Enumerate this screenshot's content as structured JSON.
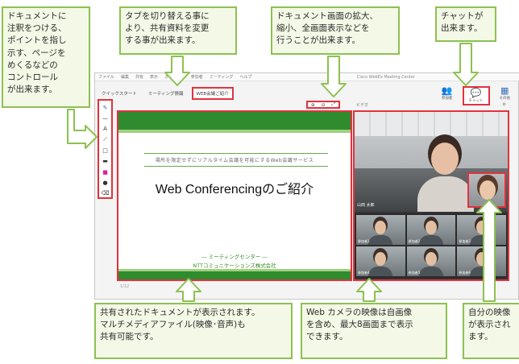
{
  "callouts": {
    "document_controls": "ドキュメントに\n注釈をつける、\nポイントを指し\n示す、ページを\nめくるなどの\nコントロール\nが出来ます。",
    "tabs": "タブを切り替える事に\nより、共有資料を変更\nする事が出来ます。",
    "zoom": "ドキュメント画面の拡大、\n縮小、全画面表示などを\n行うことが出来ます。",
    "chat": "チャットが\n出来ます。",
    "shared_document": "共有されたドキュメントが表示されます。\nマルチメディアファイル(映像･音声)も\n共有可能です。",
    "webcam": "Web カメラの映像は自画像\nを含め、最大8画面まで表示\nできます。",
    "self_view": "自分の映像\nが表示され\nます。"
  },
  "app": {
    "title": "Cisco WebEx Meeting Center",
    "menu": [
      "ファイル",
      "編集",
      "共有",
      "表示",
      "オーディオ",
      "参加者",
      "ミーティング",
      "ヘルプ"
    ],
    "tabs": [
      {
        "label": "クイックスタート",
        "active": false
      },
      {
        "label": "ミーティング情報",
        "active": false
      },
      {
        "label": "WEB会議ご紹介",
        "active": true
      }
    ],
    "add_tab": "+",
    "top_icons": [
      {
        "name": "participants",
        "label": "参加者"
      },
      {
        "name": "chat",
        "label": "チャット"
      },
      {
        "name": "more",
        "label": "その他"
      }
    ],
    "zoom_controls": [
      "⊕",
      "⊖",
      "⤢"
    ],
    "tools": [
      "✎",
      "—",
      "A",
      "⟋",
      "□",
      "▬",
      "■",
      "●",
      "⌫"
    ],
    "video_header_label": "ビデオ",
    "pager": "1/12"
  },
  "document": {
    "subtitle": "場所を限定せずにリアルタイム会議を可能にするWeb会議サービス",
    "title": "Web Conferencingのご紹介",
    "department": "― ミーティングセンター ―",
    "company": "NTTコミュニケーションズ株式会社"
  },
  "video": {
    "speaker_name": "山田 太郎",
    "thumbnails": [
      "参加者1",
      "参加者2",
      "参加者3",
      "参加者4",
      "参加者5",
      "参加者6"
    ]
  },
  "colors": {
    "callout_border": "#8cc152",
    "highlight_red": "#e2323d",
    "doc_green": "#2f8c2e"
  }
}
